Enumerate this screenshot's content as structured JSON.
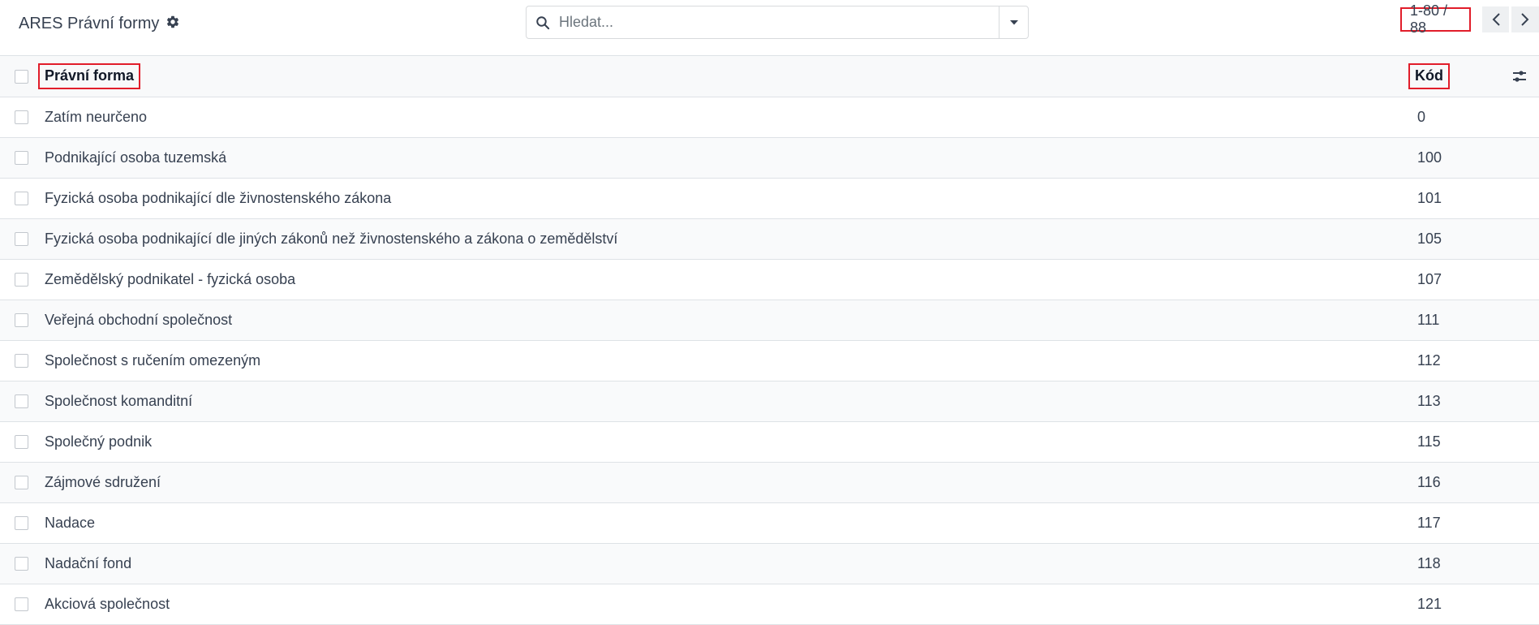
{
  "breadcrumb": {
    "title": "ARES Právní formy"
  },
  "search": {
    "placeholder": "Hledat..."
  },
  "pager": {
    "value": "1-80 / 88"
  },
  "table": {
    "columns": {
      "name": "Právní forma",
      "code": "Kód"
    },
    "rows": [
      {
        "name": "Zatím neurčeno",
        "code": "0"
      },
      {
        "name": "Podnikající osoba tuzemská",
        "code": "100"
      },
      {
        "name": "Fyzická osoba podnikající dle živnostenského zákona",
        "code": "101"
      },
      {
        "name": "Fyzická osoba podnikající dle jiných zákonů než živnostenského a zákona o zemědělství",
        "code": "105"
      },
      {
        "name": "Zemědělský podnikatel - fyzická osoba",
        "code": "107"
      },
      {
        "name": "Veřejná obchodní společnost",
        "code": "111"
      },
      {
        "name": "Společnost s ručením omezeným",
        "code": "112"
      },
      {
        "name": "Společnost komanditní",
        "code": "113"
      },
      {
        "name": "Společný podnik",
        "code": "115"
      },
      {
        "name": "Zájmové sdružení",
        "code": "116"
      },
      {
        "name": "Nadace",
        "code": "117"
      },
      {
        "name": "Nadační fond",
        "code": "118"
      },
      {
        "name": "Akciová společnost",
        "code": "121"
      }
    ]
  },
  "colors": {
    "highlight": "#e11d2a",
    "border": "#dee2e6"
  },
  "icons": {
    "settings": "gear-icon",
    "search": "search-icon",
    "search_toggle": "caret-down-icon",
    "prev": "chevron-left-icon",
    "next": "chevron-right-icon",
    "optional_columns": "sliders-icon"
  }
}
